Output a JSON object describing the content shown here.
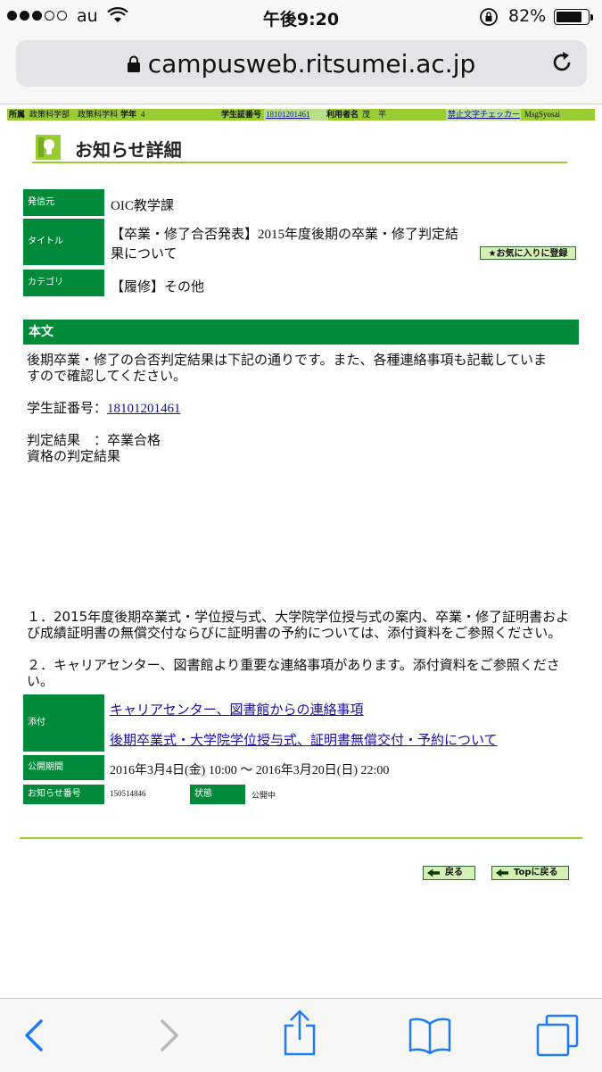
{
  "status": {
    "carrier": "au",
    "time": "午後9:20",
    "battery": "82%",
    "battery_level": 0.82
  },
  "browser": {
    "url": "campusweb.ritsumei.ac.jp"
  },
  "infobar": {
    "affiliation_label": "所属",
    "affiliation_value": "政策科学部　政策科学科",
    "year_label": "学年",
    "year_value": "4",
    "student_id_label": "学生証番号",
    "student_id_value": "18101201461",
    "user_label": "利用者名",
    "user_value": "茂　平",
    "checker_link": "禁止文字チェッカー",
    "msg": "MsgSyosai"
  },
  "page": {
    "title": "お知らせ詳細"
  },
  "meta": {
    "sender_label": "発信元",
    "sender_value": "OIC教学課",
    "title_label": "タイトル",
    "title_value_line1": "【卒業・修了合否発表】2015年度後期の卒業・修了判定結",
    "title_value_line2": "果について",
    "favorite_button": "★お気に入りに登録",
    "category_label": "カテゴリ",
    "category_value": "【履修】その他"
  },
  "body": {
    "header": "本文",
    "para1_line1": "後期卒業・修了の合否判定結果は下記の通りです。また、各種連絡事項も記載していま",
    "para1_line2": "すので確認してください。",
    "student_id_prefix": "学生証番号：",
    "student_id_link": "18101201461",
    "result_line": "判定結果　：卒業合格",
    "qualification_line": "資格の判定結果",
    "item1_line1": "１．2015年度後期卒業式・学位授与式、大学院学位授与式の案内、卒業・修了証明書およ",
    "item1_line2": "び成績証明書の無償交付ならびに証明書の予約については、添付資料をご参照ください。",
    "item2_line1": "２．キャリアセンター、図書館より重要な連絡事項があります。添付資料をご参照くださ",
    "item2_line2": "い。"
  },
  "footer_meta": {
    "attachment_label": "添付",
    "attachment1": "キャリアセンター、図書館からの連絡事項",
    "attachment2": "後期卒業式・大学院学位授与式、証明書無償交付・予約について",
    "period_label": "公開期間",
    "period_value": "2016年3月4日(金) 10:00 〜 2016年3月20日(日) 22:00",
    "notice_no_label": "お知らせ番号",
    "notice_no_value": "150514846",
    "state_label": "状態",
    "state_value": "公開中"
  },
  "nav": {
    "back_label": "戻る",
    "top_label": "Topに戻る"
  },
  "colors": {
    "label_green": "#008a3a",
    "accent_lime": "#99cc33",
    "link": "#1a0dab"
  }
}
